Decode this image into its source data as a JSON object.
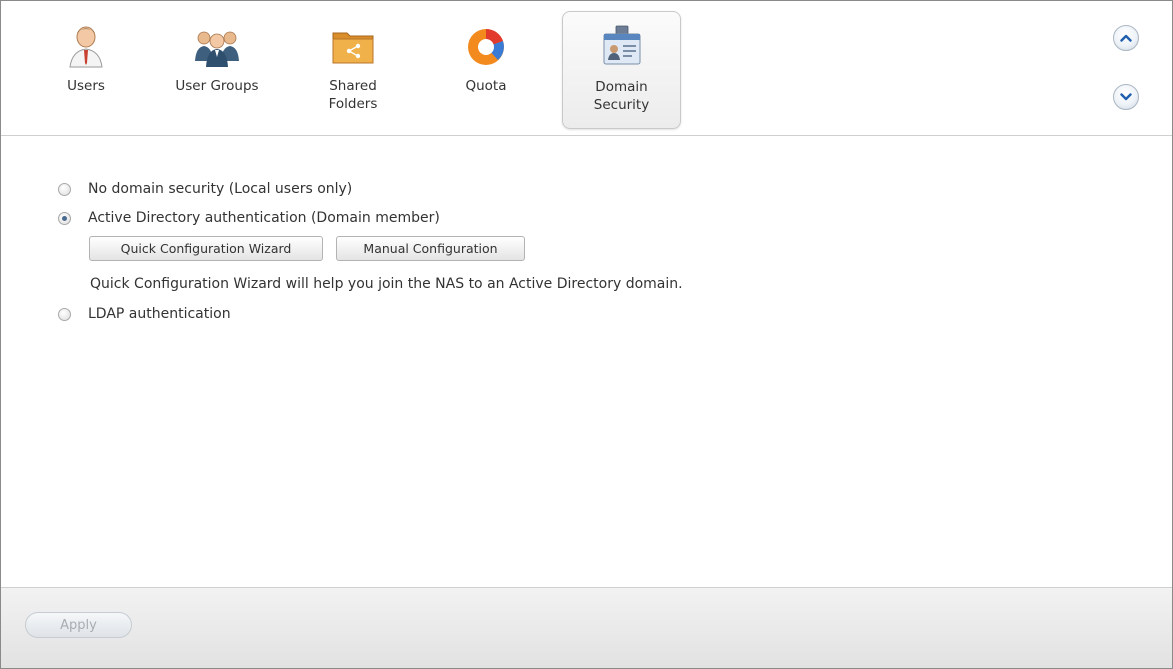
{
  "toolbar": {
    "tabs": [
      {
        "label": "Users",
        "icon": "user-icon"
      },
      {
        "label": "User Groups",
        "icon": "user-groups-icon"
      },
      {
        "label": "Shared\nFolders",
        "icon": "shared-folder-icon"
      },
      {
        "label": "Quota",
        "icon": "quota-pie-icon"
      },
      {
        "label": "Domain\nSecurity",
        "icon": "domain-security-icon"
      }
    ],
    "active_tab": "Domain\nSecurity",
    "nav": {
      "up_icon": "chevron-up-icon",
      "down_icon": "chevron-down-icon"
    }
  },
  "domain_security": {
    "options": [
      {
        "label": "No domain security (Local users only)",
        "checked": false
      },
      {
        "label": "Active Directory authentication (Domain member)",
        "checked": true
      },
      {
        "label": "LDAP authentication",
        "checked": false
      }
    ],
    "buttons": {
      "wizard_label": "Quick Configuration Wizard",
      "manual_label": "Manual Configuration"
    },
    "hint": "Quick Configuration Wizard will help you join the NAS to an Active Directory domain."
  },
  "footer": {
    "apply_label": "Apply",
    "apply_enabled": false
  },
  "colors": {
    "accent": "#4a6a8f",
    "disabled_text": "#a7adb3"
  }
}
